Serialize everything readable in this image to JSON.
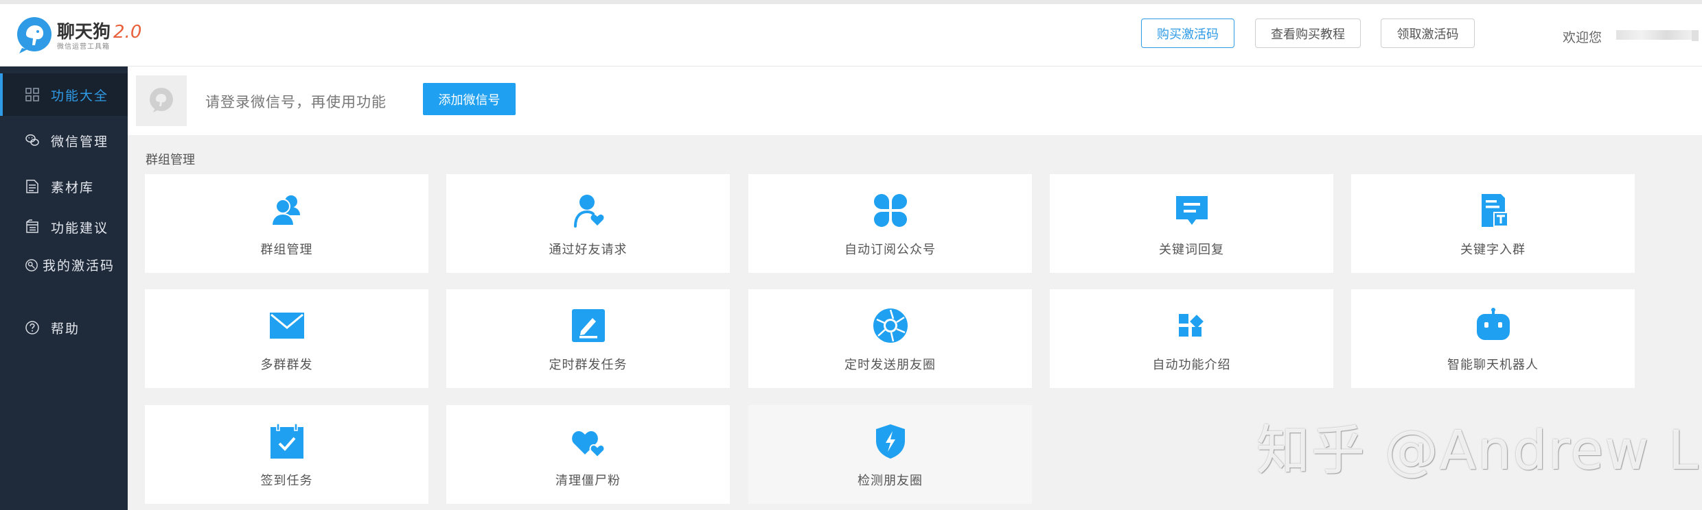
{
  "brand": {
    "name": "聊天狗",
    "version": "2.0",
    "tagline": "微信运营工具箱",
    "accent_color": "#2f9be6",
    "version_color": "#e8603c"
  },
  "header": {
    "buy_code_label": "购买激活码",
    "tutorial_label": "查看购买教程",
    "get_code_label": "领取激活码",
    "welcome_text": "欢迎您"
  },
  "sidebar": {
    "items": [
      {
        "label": "功能大全",
        "icon": "grid-icon",
        "active": true
      },
      {
        "label": "微信管理",
        "icon": "wechat-icon",
        "active": false
      },
      {
        "label": "素材库",
        "icon": "archive-icon",
        "active": false
      },
      {
        "label": "功能建议",
        "icon": "document-icon",
        "active": false
      },
      {
        "label": "我的激活码",
        "icon": "activation-icon",
        "active": false
      },
      {
        "label": "帮助",
        "icon": "help-icon",
        "active": false
      }
    ]
  },
  "login": {
    "message": "请登录微信号，再使用功能",
    "add_button": "添加微信号"
  },
  "section": {
    "title": "群组管理"
  },
  "features": [
    {
      "label": "群组管理",
      "icon": "users-icon"
    },
    {
      "label": "通过好友请求",
      "icon": "user-heart-icon"
    },
    {
      "label": "自动订阅公众号",
      "icon": "clover-icon"
    },
    {
      "label": "关键词回复",
      "icon": "message-icon"
    },
    {
      "label": "关键字入群",
      "icon": "text-doc-icon"
    },
    {
      "label": "多群群发",
      "icon": "envelope-icon"
    },
    {
      "label": "定时群发任务",
      "icon": "edit-icon"
    },
    {
      "label": "定时发送朋友圈",
      "icon": "aperture-icon"
    },
    {
      "label": "自动功能介绍",
      "icon": "blocks-icon"
    },
    {
      "label": "智能聊天机器人",
      "icon": "robot-icon"
    },
    {
      "label": "签到任务",
      "icon": "calendar-check-icon"
    },
    {
      "label": "清理僵尸粉",
      "icon": "hearts-icon"
    },
    {
      "label": "检测朋友圈",
      "icon": "shield-bolt-icon"
    }
  ],
  "watermark": "知乎 @Andrew Li"
}
